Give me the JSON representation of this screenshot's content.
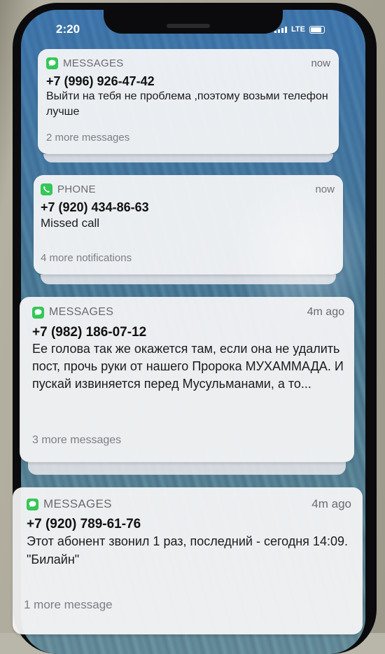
{
  "status_bar": {
    "time": "2:20",
    "network": "LTE"
  },
  "notifications": [
    {
      "app": "MESSAGES",
      "app_icon": "messages-bubble-icon",
      "time": "now",
      "sender": "+7 (996) 926-47-42",
      "body": "Выйти на тебя не проблема ,поэтому возьми телефон лучше",
      "more": "2 more messages"
    },
    {
      "app": "PHONE",
      "app_icon": "phone-handset-icon",
      "time": "now",
      "sender": "+7 (920) 434-86-63",
      "body": "Missed call",
      "more": "4 more notifications"
    },
    {
      "app": "MESSAGES",
      "app_icon": "messages-bubble-icon",
      "time": "4m ago",
      "sender": "+7 (982) 186-07-12",
      "body": "Ее голова так же окажется там, если она не удалить пост, прочь руки от нашего Пророка МУХАММАДА. И пускай извиняется перед Мусульманами, а то...",
      "more": "3 more messages"
    },
    {
      "app": "MESSAGES",
      "app_icon": "messages-bubble-icon",
      "time": "4m ago",
      "sender": "+7 (920) 789-61-76",
      "body": "Этот абонент звонил 1 раз, последний - сегодня 14:09. \"Билайн\"",
      "more": "1 more message"
    }
  ],
  "colors": {
    "app_icon_green": "#34c759",
    "card_background": "#f4f4f6",
    "secondary_text": "#6a6a70"
  }
}
